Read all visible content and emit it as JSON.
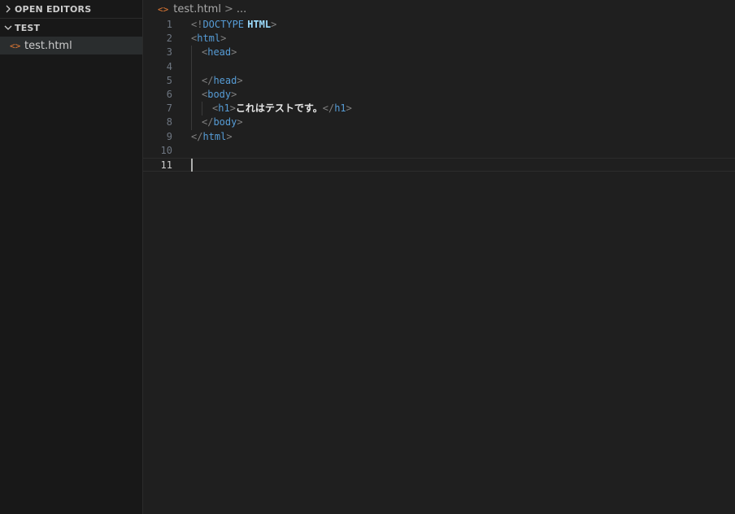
{
  "sidebar": {
    "open_editors_label": "OPEN EDITORS",
    "folder_label": "TEST",
    "files": [
      {
        "icon": "<>",
        "name": "test.html"
      }
    ]
  },
  "breadcrumb": {
    "icon": "<>",
    "file": "test.html",
    "separator": ">",
    "rest": "..."
  },
  "editor": {
    "current_line": 11,
    "lines": [
      {
        "n": "1",
        "tokens": [
          [
            "<!",
            "bracket"
          ],
          [
            "DOCTYPE",
            "kw"
          ],
          [
            " ",
            "text"
          ],
          [
            "HTML",
            "doctype"
          ],
          [
            ">",
            "bracket"
          ]
        ],
        "indent": 0
      },
      {
        "n": "2",
        "tokens": [
          [
            "<",
            "bracket"
          ],
          [
            "html",
            "tag"
          ],
          [
            ">",
            "bracket"
          ]
        ],
        "indent": 0
      },
      {
        "n": "3",
        "tokens": [
          [
            "<",
            "bracket"
          ],
          [
            "head",
            "tag"
          ],
          [
            ">",
            "bracket"
          ]
        ],
        "indent": 1
      },
      {
        "n": "4",
        "tokens": [],
        "indent": 1
      },
      {
        "n": "5",
        "tokens": [
          [
            "</",
            "bracket"
          ],
          [
            "head",
            "tag"
          ],
          [
            ">",
            "bracket"
          ]
        ],
        "indent": 1
      },
      {
        "n": "6",
        "tokens": [
          [
            "<",
            "bracket"
          ],
          [
            "body",
            "tag"
          ],
          [
            ">",
            "bracket"
          ]
        ],
        "indent": 1
      },
      {
        "n": "7",
        "tokens": [
          [
            "<",
            "bracket"
          ],
          [
            "h1",
            "tag"
          ],
          [
            ">",
            "bracket"
          ],
          [
            "これはテストです。",
            "text"
          ],
          [
            "</",
            "bracket"
          ],
          [
            "h1",
            "tag"
          ],
          [
            ">",
            "bracket"
          ]
        ],
        "indent": 2
      },
      {
        "n": "8",
        "tokens": [
          [
            "</",
            "bracket"
          ],
          [
            "body",
            "tag"
          ],
          [
            ">",
            "bracket"
          ]
        ],
        "indent": 1
      },
      {
        "n": "9",
        "tokens": [
          [
            "</",
            "bracket"
          ],
          [
            "html",
            "tag"
          ],
          [
            ">",
            "bracket"
          ]
        ],
        "indent": 0
      },
      {
        "n": "10",
        "tokens": [],
        "indent": 0
      },
      {
        "n": "11",
        "tokens": [],
        "indent": 0
      }
    ]
  }
}
